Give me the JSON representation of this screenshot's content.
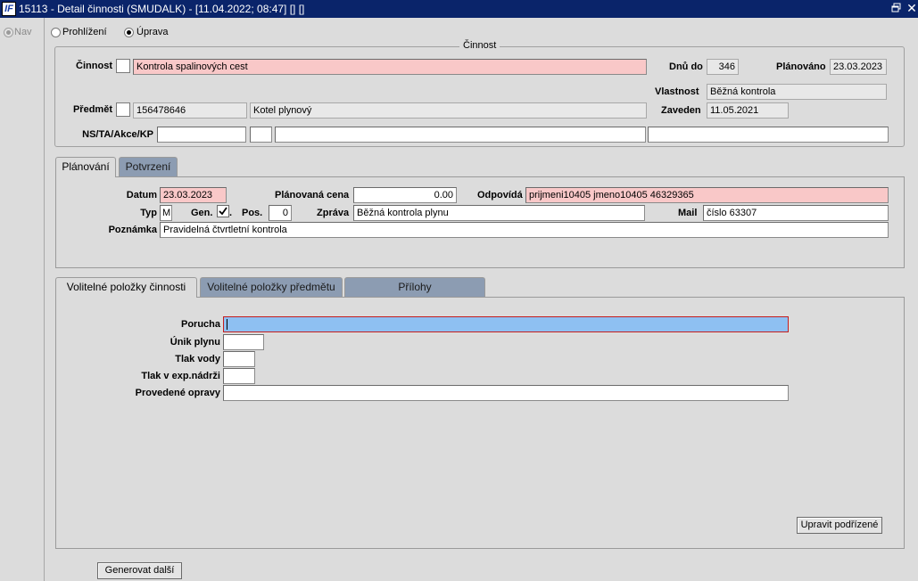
{
  "window": {
    "title": "15113 - Detail činnosti (SMUDALK) - [11.04.2022; 08:47] [] []",
    "logo": "IF",
    "close_glyph": "✕"
  },
  "nav": {
    "label": "Nav"
  },
  "mode": {
    "browse_label": "Prohlížení",
    "edit_label": "Úprava",
    "selected": "Úprava"
  },
  "cinnost_group": {
    "legend": "Činnost",
    "cinnost_label": "Činnost",
    "cinnost_value": "Kontrola spalinových cest",
    "dnu_do_label": "Dnů do",
    "dnu_do_value": "346",
    "planovano_label": "Plánováno",
    "planovano_value": "23.03.2023",
    "vlastnost_label": "Vlastnost",
    "vlastnost_value": "Běžná kontrola",
    "predmet_label": "Předmět",
    "predmet_code": "156478646",
    "predmet_name": "Kotel plynový",
    "zaveden_label": "Zaveden",
    "zaveden_value": "11.05.2021",
    "ns_label": "NS/TA/Akce/KP",
    "ns_values": [
      "",
      "",
      "",
      ""
    ]
  },
  "top_tabs": [
    {
      "label": "Plánování",
      "active": true
    },
    {
      "label": "Potvrzení",
      "active": false
    }
  ],
  "planovani": {
    "datum_label": "Datum",
    "datum_value": "23.03.2023",
    "cena_label": "Plánovaná cena",
    "cena_value": "0.00",
    "odpovida_label": "Odpovídá",
    "odpovida_value": "prijmeni10405 jmeno10405 46329365",
    "typ_label": "Typ",
    "typ_value": "M",
    "gen_label": "Gen.",
    "gen_checked": true,
    "pos_label": "Pos.",
    "pos_value": "0",
    "zprava_label": "Zpráva",
    "zprava_value": "Běžná kontrola plynu",
    "mail_label": "Mail",
    "mail_value": "číslo 63307",
    "poznamka_label": "Poznámka",
    "poznamka_value": "Pravidelná čtvrtletní kontrola"
  },
  "bottom_tabs": [
    {
      "label": "Volitelné položky činnosti",
      "active": true
    },
    {
      "label": "Volitelné položky předmětu",
      "active": false
    },
    {
      "label": "Přílohy",
      "active": false
    }
  ],
  "volitelne": {
    "porucha_label": "Porucha",
    "porucha_value": "",
    "unik_label": "Únik plynu",
    "unik_value": "",
    "tlak_vody_label": "Tlak vody",
    "tlak_vody_value": "",
    "tlak_exp_label": "Tlak v exp.nádrži",
    "tlak_exp_value": "",
    "opravy_label": "Provedené opravy",
    "opravy_value": "",
    "upravit_button": "Upravit podřízené"
  },
  "footer": {
    "generovat_button": "Generovat další"
  },
  "colors": {
    "titlebar": "#0a246a",
    "required_field": "#f9c8c8",
    "focused_field": "#8ec0f2",
    "inactive_tab": "#8c9cb2"
  }
}
